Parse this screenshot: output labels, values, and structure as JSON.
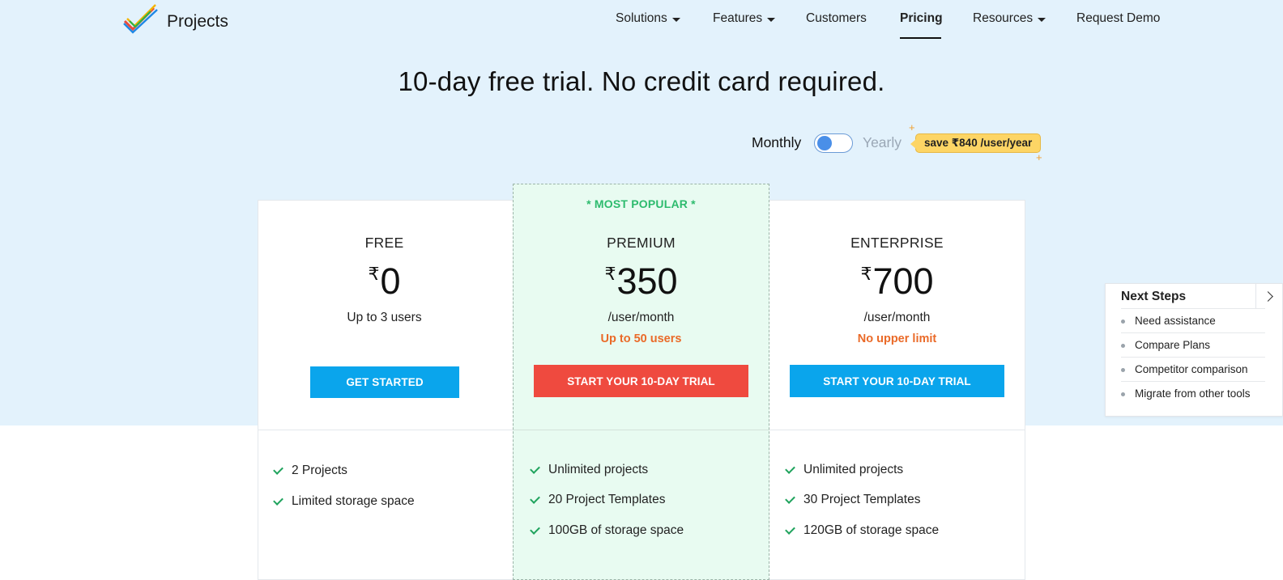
{
  "brand": {
    "name": "Projects"
  },
  "nav": {
    "items": [
      {
        "label": "Solutions",
        "dropdown": true
      },
      {
        "label": "Features",
        "dropdown": true
      },
      {
        "label": "Customers",
        "dropdown": false
      },
      {
        "label": "Pricing",
        "dropdown": false,
        "active": true
      },
      {
        "label": "Resources",
        "dropdown": true
      },
      {
        "label": "Request Demo",
        "dropdown": false
      }
    ]
  },
  "headline": "10-day free trial. No credit card required.",
  "billing": {
    "monthly_label": "Monthly",
    "yearly_label": "Yearly",
    "selected": "Monthly",
    "save_badge": "save ₹840 /user/year"
  },
  "plans": [
    {
      "name": "FREE",
      "currency": "₹",
      "price": "0",
      "sub": "Up to 3 users",
      "limit": "",
      "cta": "GET STARTED",
      "features": [
        "2 Projects",
        "Limited storage space"
      ]
    },
    {
      "badge": "* MOST POPULAR *",
      "name": "PREMIUM",
      "currency": "₹",
      "price": "350",
      "sub": "/user/month",
      "limit": "Up to 50 users",
      "cta": "START YOUR 10-DAY TRIAL",
      "features": [
        "Unlimited projects",
        "20 Project Templates",
        "100GB of storage space"
      ]
    },
    {
      "name": "ENTERPRISE",
      "currency": "₹",
      "price": "700",
      "sub": "/user/month",
      "limit": "No upper limit",
      "cta": "START YOUR 10-DAY TRIAL",
      "features": [
        "Unlimited projects",
        "30 Project Templates",
        "120GB of storage space"
      ]
    }
  ],
  "next_steps": {
    "title": "Next Steps",
    "items": [
      "Need assistance",
      "Compare Plans",
      "Competitor comparison",
      "Migrate from other tools"
    ]
  },
  "colors": {
    "hero_bg": "#e3f2fc",
    "premium_bg": "#e8fbf1",
    "cta_blue": "#0aa5ec",
    "cta_red": "#ef4a3f",
    "accent_orange": "#ea6a28",
    "popular_green": "#2dbb6e",
    "badge_yellow": "#fdd565"
  }
}
